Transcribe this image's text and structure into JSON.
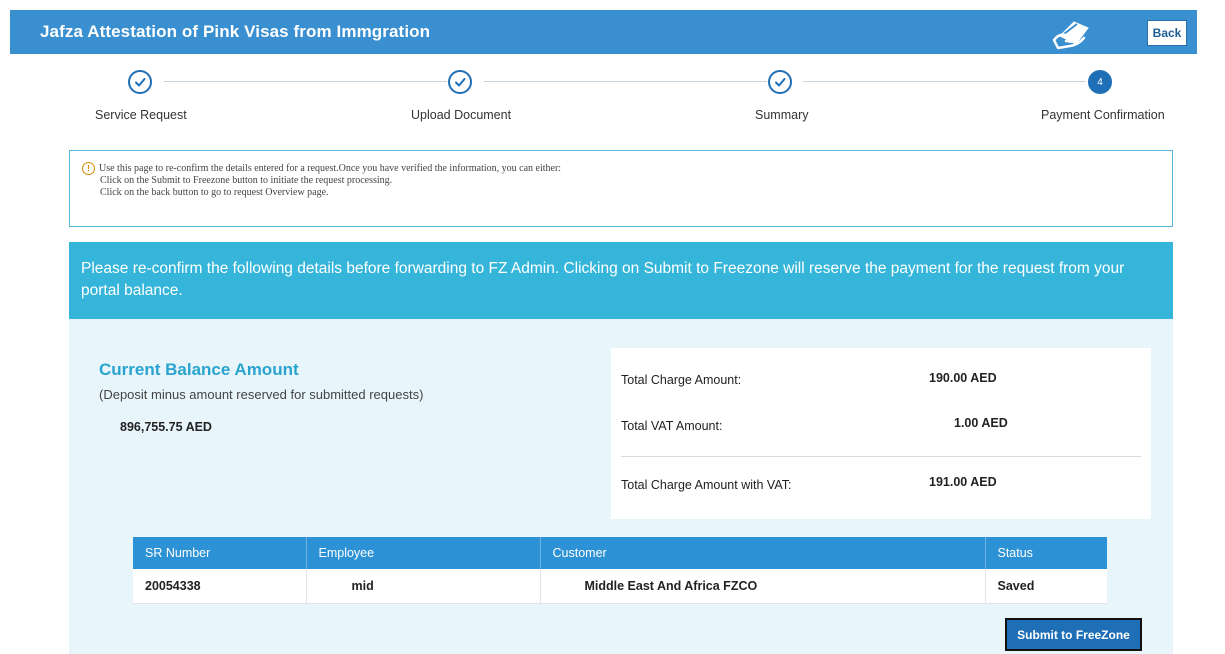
{
  "header": {
    "title": "Jafza Attestation of Pink Visas from Immgration",
    "back_label": "Back",
    "icon": "payment-card-hand-icon"
  },
  "steps": [
    {
      "label": "Service Request",
      "state": "done"
    },
    {
      "label": "Upload Document",
      "state": "done"
    },
    {
      "label": "Summary",
      "state": "done"
    },
    {
      "label": "Payment Confirmation",
      "state": "active",
      "number": "4"
    }
  ],
  "info": {
    "line1": "Use this page to re-confirm the details entered for a request.Once you have verified the information, you can either:",
    "line2": "Click on the Submit to Freezone button to initiate the request processing.",
    "line3": "Click on the back button to go to request Overview page."
  },
  "banner": {
    "text": "Please re-confirm the following details before forwarding to FZ Admin. Clicking on Submit to Freezone will reserve the payment for the request from your portal balance."
  },
  "balance": {
    "title": "Current Balance Amount",
    "subtitle": "(Deposit minus amount reserved for submitted requests)",
    "amount": "896,755.75 AED"
  },
  "charges": {
    "total_label": "Total Charge Amount:",
    "total_value": "190.00 AED",
    "vat_label": "Total VAT Amount:",
    "vat_value": "1.00 AED",
    "total_vat_label": "Total Charge Amount with VAT:",
    "total_vat_value": "191.00 AED"
  },
  "table": {
    "columns": [
      "SR Number",
      "Employee",
      "Customer",
      "Status"
    ],
    "rows": [
      {
        "sr_number": "20054338",
        "employee": "mid",
        "customer": "Middle East And Africa FZCO",
        "status": "Saved"
      }
    ]
  },
  "actions": {
    "submit_label": "Submit to FreeZone"
  },
  "colors": {
    "header_bg": "#3a8fd0",
    "banner_bg": "#35b5d9",
    "panel_bg": "#e8f6fb",
    "table_header_bg": "#2d92d5",
    "accent": "#1f6fb7"
  }
}
